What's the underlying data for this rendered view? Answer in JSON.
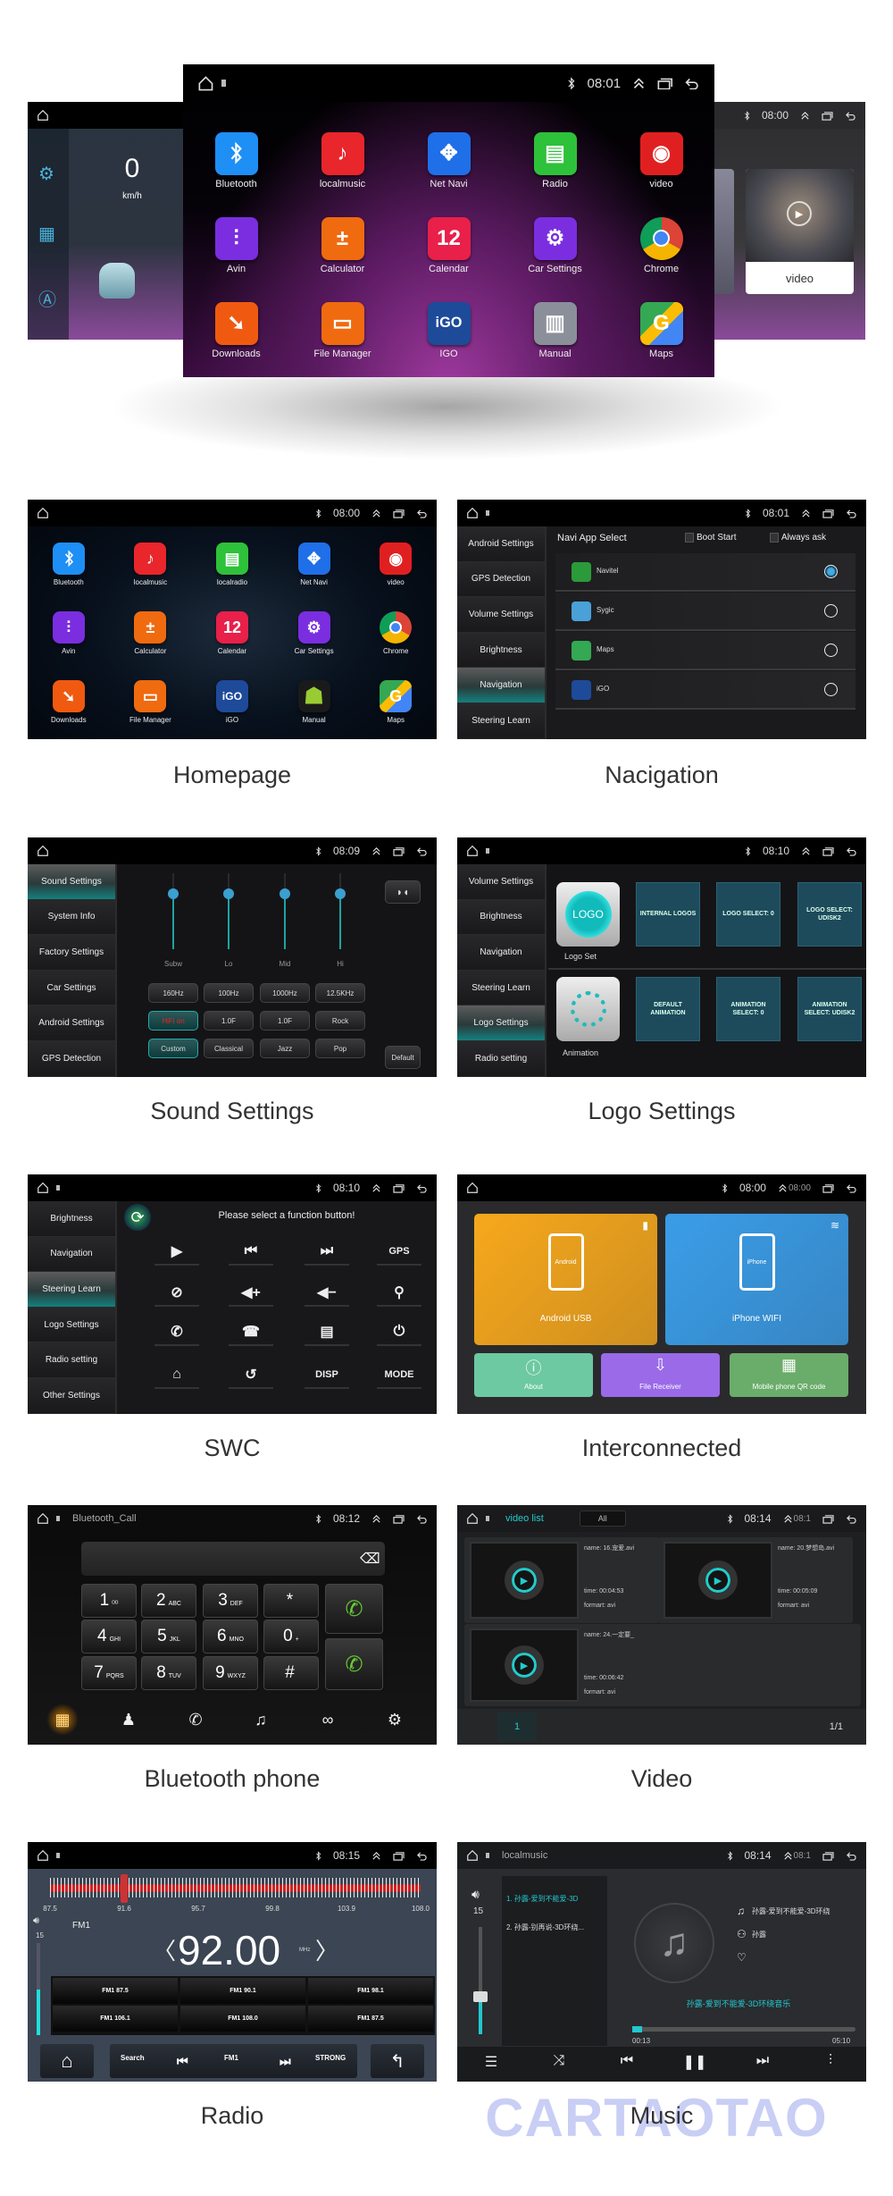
{
  "hero": {
    "center": {
      "time": "08:01",
      "apps": [
        {
          "label": "Bluetooth",
          "icon": "bluetooth",
          "color": "#1e8ff5"
        },
        {
          "label": "localmusic",
          "icon": "music-note",
          "color": "#e8262c"
        },
        {
          "label": "Net Navi",
          "icon": "compass",
          "color": "#1f6fe8"
        },
        {
          "label": "Radio",
          "icon": "radio",
          "color": "#2ec13a"
        },
        {
          "label": "video",
          "icon": "play-circle",
          "color": "#e02020"
        },
        {
          "label": "Avin",
          "icon": "equalizer",
          "color": "#7a2ee0"
        },
        {
          "label": "Calculator",
          "icon": "calculator",
          "color": "#f06a10"
        },
        {
          "label": "Calendar",
          "icon": "calendar",
          "color": "#e8204a"
        },
        {
          "label": "Car Settings",
          "icon": "gear",
          "color": "#7a2ee0"
        },
        {
          "label": "Chrome",
          "icon": "chrome",
          "color": "#db4437"
        },
        {
          "label": "Downloads",
          "icon": "download-arrow",
          "color": "#f05a10"
        },
        {
          "label": "File Manager",
          "icon": "folder",
          "color": "#f06a10"
        },
        {
          "label": "IGO",
          "icon": "igo",
          "color": "#1e4a9a"
        },
        {
          "label": "Manual",
          "icon": "book",
          "color": "#8a8f99"
        },
        {
          "label": "Maps",
          "icon": "maps",
          "color": "#34a853"
        }
      ]
    },
    "left": {
      "speed": "0",
      "unit": "km/h"
    },
    "right": {
      "time": "08:00",
      "card_label": "video"
    }
  },
  "panels": {
    "homepage": {
      "caption": "Homepage",
      "time": "08:00",
      "apps": [
        {
          "label": "Bluetooth",
          "icon": "bluetooth",
          "color": "#1e8ff5"
        },
        {
          "label": "localmusic",
          "icon": "music-note",
          "color": "#e8262c"
        },
        {
          "label": "localradio",
          "icon": "radio",
          "color": "#2ec13a"
        },
        {
          "label": "Net Navi",
          "icon": "compass",
          "color": "#1f6fe8"
        },
        {
          "label": "video",
          "icon": "play-circle",
          "color": "#e02020"
        },
        {
          "label": "Avin",
          "icon": "equalizer",
          "color": "#7a2ee0"
        },
        {
          "label": "Calculator",
          "icon": "calculator",
          "color": "#f06a10"
        },
        {
          "label": "Calendar",
          "icon": "calendar",
          "color": "#e8204a"
        },
        {
          "label": "Car Settings",
          "icon": "gear",
          "color": "#7a2ee0"
        },
        {
          "label": "Chrome",
          "icon": "chrome",
          "color": "#db4437"
        },
        {
          "label": "Downloads",
          "icon": "download-arrow",
          "color": "#f05a10"
        },
        {
          "label": "File Manager",
          "icon": "folder",
          "color": "#f06a10"
        },
        {
          "label": "iGO",
          "icon": "igo",
          "color": "#1e4a9a"
        },
        {
          "label": "Manual",
          "icon": "android",
          "color": "#1a1a1a"
        },
        {
          "label": "Maps",
          "icon": "maps",
          "color": "#34a853"
        }
      ]
    },
    "navigation": {
      "caption": "Nacigation",
      "time": "08:01",
      "sidebar": [
        "Android Settings",
        "GPS Detection",
        "Volume Settings",
        "Brightness",
        "Navigation",
        "Steering Learn"
      ],
      "active_index": 4,
      "title": "Navi App Select",
      "boot_start": "Boot Start",
      "always_ask": "Always ask",
      "apps": [
        {
          "label": "Navitel",
          "color": "#2b9a3a",
          "selected": true
        },
        {
          "label": "Sygic",
          "color": "#4aa0d8",
          "selected": false
        },
        {
          "label": "Maps",
          "color": "#34a853",
          "selected": false
        },
        {
          "label": "iGO",
          "color": "#1e4a9a",
          "selected": false
        }
      ]
    },
    "sound": {
      "caption": "Sound Settings",
      "time": "08:09",
      "sidebar": [
        "Sound Settings",
        "System Info",
        "Factory Settings",
        "Car Settings",
        "Android Settings",
        "GPS Detection"
      ],
      "active_index": 0,
      "sliders": [
        {
          "label": "Subw",
          "value": 0.5
        },
        {
          "label": "Lo",
          "value": 0.5
        },
        {
          "label": "Mid",
          "value": 0.5
        },
        {
          "label": "Hi",
          "value": 0.5
        }
      ],
      "buttons": [
        [
          "160Hz",
          "100Hz",
          "1000Hz",
          "12.5KHz"
        ],
        [
          "HiFi on",
          "1.0F",
          "1.0F",
          "Rock"
        ],
        [
          "Custom",
          "Classical",
          "Jazz",
          "Pop"
        ]
      ],
      "default_label": "Default",
      "accent": "#1fa3a0"
    },
    "logo": {
      "caption": "Logo Settings",
      "time": "08:10",
      "sidebar": [
        "Volume Settings",
        "Brightness",
        "Navigation",
        "Steering Learn",
        "Logo Settings",
        "Radio setting"
      ],
      "active_index": 4,
      "logo_icon_text": "LOGO",
      "logo_set": "Logo Set",
      "animation": "Animation",
      "logo_tiles": [
        "INTERNAL LOGOS",
        "LOGO SELECT: 0",
        "LOGO SELECT: UDISK2"
      ],
      "animation_tiles": [
        "DEFAULT ANIMATION",
        "ANIMATION SELECT: 0",
        "ANIMATION SELECT: UDISK2"
      ]
    },
    "swc": {
      "caption": "SWC",
      "time": "08:10",
      "sidebar": [
        "Brightness",
        "Navigation",
        "Steering Learn",
        "Logo Settings",
        "Radio setting",
        "Other Settings"
      ],
      "active_index": 2,
      "prompt": "Please select a function button!",
      "functions": [
        {
          "icon": "play-icon"
        },
        {
          "icon": "previous-icon"
        },
        {
          "icon": "next-icon"
        },
        {
          "label": "GPS"
        },
        {
          "icon": "mute-icon"
        },
        {
          "icon": "volume-up-icon"
        },
        {
          "icon": "volume-down-icon"
        },
        {
          "icon": "microphone-icon"
        },
        {
          "icon": "phone-icon"
        },
        {
          "icon": "hang-up-icon"
        },
        {
          "icon": "radio-icon"
        },
        {
          "icon": "power-icon"
        },
        {
          "icon": "home-icon"
        },
        {
          "icon": "back-icon"
        },
        {
          "label": "DISP"
        },
        {
          "label": "MODE"
        }
      ]
    },
    "interconnected": {
      "caption": "Interconnected",
      "time": "08:00",
      "ghost_time": "08:00",
      "android": {
        "label": "Android USB",
        "phone_text": "Android",
        "color": "#f7a81c"
      },
      "iphone": {
        "label": "iPhone WIFI",
        "phone_text": "iPhone",
        "color": "#3a9de8"
      },
      "about": {
        "label": "About",
        "color": "#6cc9a2"
      },
      "file_receiver": {
        "label": "File Receiver",
        "color": "#9a6ae8"
      },
      "qr": {
        "label": "Mobile phone QR code",
        "color": "#6aac6a"
      }
    },
    "bluetooth": {
      "caption": "Bluetooth phone",
      "time": "08:12",
      "title": "Bluetooth_Call",
      "keys": [
        {
          "d": "1",
          "s": "ᴼᴼ"
        },
        {
          "d": "2",
          "s": "ABC"
        },
        {
          "d": "3",
          "s": "DEF"
        },
        {
          "d": "*",
          "s": ""
        },
        {
          "d": "4",
          "s": "GHI"
        },
        {
          "d": "5",
          "s": "JKL"
        },
        {
          "d": "6",
          "s": "MNO"
        },
        {
          "d": "0",
          "s": "+"
        },
        {
          "d": "7",
          "s": "PQRS"
        },
        {
          "d": "8",
          "s": "TUV"
        },
        {
          "d": "9",
          "s": "WXYZ"
        },
        {
          "d": "#",
          "s": ""
        }
      ],
      "bottom_icons": [
        "dialpad-icon",
        "contacts-icon",
        "call-log-icon",
        "music-icon",
        "link-icon",
        "settings-icon"
      ],
      "active_bottom": 0
    },
    "video": {
      "caption": "Video",
      "time": "08:14",
      "ghost_time": "08:1",
      "title": "video list",
      "tab": "All",
      "items": [
        {
          "name": "name: 16.宠爱.avi",
          "time": "time: 00:04:53",
          "format": "formart: avi"
        },
        {
          "name": "name: 20.梦想岛.avi",
          "time": "time: 00:05:09",
          "format": "formart: avi"
        },
        {
          "name": "name: 24.一定要_",
          "time": "time: 00:06:42",
          "format": "formart: avi"
        }
      ],
      "page": "1",
      "pages": "1/1"
    },
    "radio": {
      "caption": "Radio",
      "time": "08:15",
      "scale": [
        "87.5",
        "91.6",
        "95.7",
        "99.8",
        "103.9",
        "108.0"
      ],
      "scale_min": 87.5,
      "scale_max": 108.0,
      "band": "FM1",
      "volume": "15",
      "volume_level": 0.5,
      "frequency": "92.00",
      "unit": "MHz",
      "marker_freq": 91.6,
      "presets": [
        "FM1 87.5",
        "FM1 90.1",
        "FM1 98.1",
        "FM1 106.1",
        "FM1 108.0",
        "FM1 87.5"
      ],
      "search": "Search",
      "mode": "FM1",
      "strong": "STRONG",
      "accent": "#d02020"
    },
    "music": {
      "caption": "Music",
      "time": "08:14",
      "ghost_time": "08:1",
      "title": "localmusic",
      "volume": "15",
      "volume_level": 0.35,
      "playlist": [
        "1. 孙露-爱到不能爱-3D",
        "2. 孙露-别再说-3D环绕..."
      ],
      "song": "孙露-爱到不能爱-3D环绕",
      "artist": "孙露",
      "now_playing": "孙露-爱到不能爱-3D环绕音乐",
      "elapsed": "00:13",
      "duration": "05:10",
      "progress": 0.042,
      "accent": "#22c8d0"
    }
  },
  "watermark": "CARTAOTAO"
}
